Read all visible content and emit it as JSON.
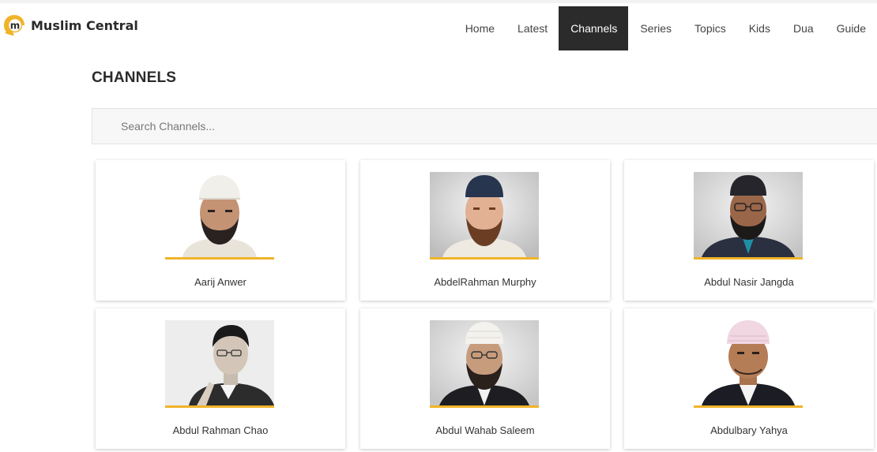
{
  "header": {
    "logo_text": "Muslim Central",
    "brand_color": "#f0b429",
    "nav": [
      {
        "label": "Home",
        "active": false
      },
      {
        "label": "Latest",
        "active": false
      },
      {
        "label": "Channels",
        "active": true
      },
      {
        "label": "Series",
        "active": false
      },
      {
        "label": "Topics",
        "active": false
      },
      {
        "label": "Kids",
        "active": false
      },
      {
        "label": "Dua",
        "active": false
      },
      {
        "label": "Guide",
        "active": false
      }
    ]
  },
  "main": {
    "title": "CHANNELS",
    "search": {
      "placeholder": "Search Channels...",
      "value": ""
    },
    "channels": [
      {
        "name": "Aarij Anwer",
        "photo": "portrait-white-kufi"
      },
      {
        "name": "AbdelRahman Murphy",
        "photo": "portrait-navy-kufi"
      },
      {
        "name": "Abdul Nasir Jangda",
        "photo": "portrait-dark-kufi-glasses"
      },
      {
        "name": "Abdul Rahman Chao",
        "photo": "portrait-grayscale-suit"
      },
      {
        "name": "Abdul Wahab Saleem",
        "photo": "portrait-white-kufi-glasses"
      },
      {
        "name": "Abdulbary Yahya",
        "photo": "portrait-pink-kufi"
      }
    ]
  }
}
